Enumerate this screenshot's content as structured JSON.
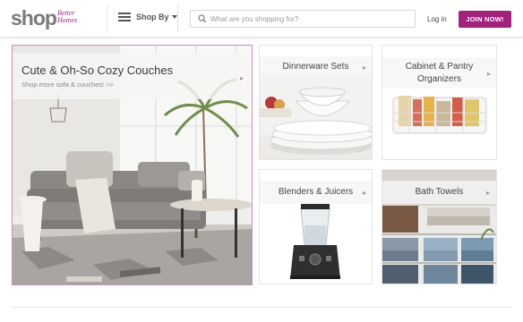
{
  "header": {
    "logo_main": "shop",
    "logo_sub": "Better Homes",
    "shop_by_label": "Shop By",
    "search_placeholder": "What are you shopping for?",
    "login_label": "Log in",
    "join_label": "JOIN NOW!"
  },
  "tiles": {
    "featured": {
      "title": "Cute & Oh-So Cozy Couches",
      "subtitle": "Shop more sofa & couches! >>"
    },
    "dinnerware": {
      "title": "Dinnerware Sets"
    },
    "cabinet": {
      "title": "Cabinet & Pantry Organizers"
    },
    "blenders": {
      "title": "Blenders & Juicers"
    },
    "bath": {
      "title": "Bath Towels"
    }
  },
  "colors": {
    "brand": "#a3217d",
    "logo_gray": "#7b7b7b",
    "tile_border": "#e3e3e3",
    "featured_border": "#c58ec0"
  }
}
